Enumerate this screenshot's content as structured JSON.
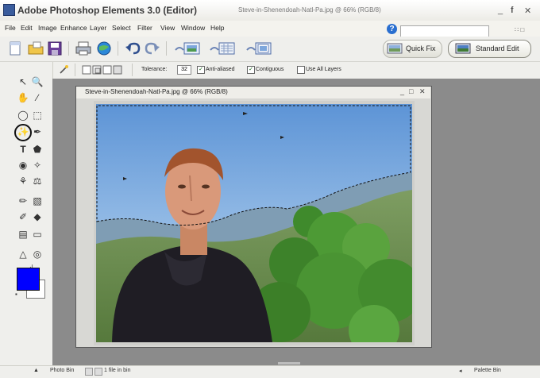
{
  "titlebar": {
    "app_title": "Adobe Photoshop Elements 3.0 (Editor)",
    "doc_title": "Steve-in-Shenendoah-Natl-Pa.jpg @ 66% (RGB/8)",
    "minimize": "_",
    "restore": "ņ",
    "close": "✕"
  },
  "menu": {
    "items": [
      "File",
      "Edit",
      "Image",
      "Enhance",
      "Layer",
      "Select",
      "Filter",
      "View",
      "Window",
      "Help"
    ],
    "help_icon": "help-icon",
    "search_placeholder": ""
  },
  "shortcuts": {
    "quick_fix": "Quick Fix",
    "standard_edit": "Standard Edit"
  },
  "options": {
    "tolerance_label": "Tolerance:",
    "tolerance_value": "32",
    "anti_aliased_label": "Anti-aliased",
    "anti_aliased_checked": true,
    "contiguous_label": "Contiguous",
    "contiguous_checked": true,
    "use_all_layers_label": "Use All Layers",
    "use_all_layers_checked": false
  },
  "document": {
    "title": "Steve-in-Shenendoah-Natl-Pa.jpg @ 66% (RGB/8)",
    "minimize": "_",
    "maximize": "□",
    "close": "✕"
  },
  "toolbox": {
    "foreground_color": "#0000ff",
    "background_color": "#ffffff",
    "selected_tool": "magic-wand"
  },
  "status": {
    "photo_bin": "Photo Bin",
    "files_in_bin": "1 file in bin",
    "palette_bin": "Palette Bin"
  },
  "colors": {
    "sky": "#7fa9d8",
    "accent": "#2a6fd0"
  }
}
